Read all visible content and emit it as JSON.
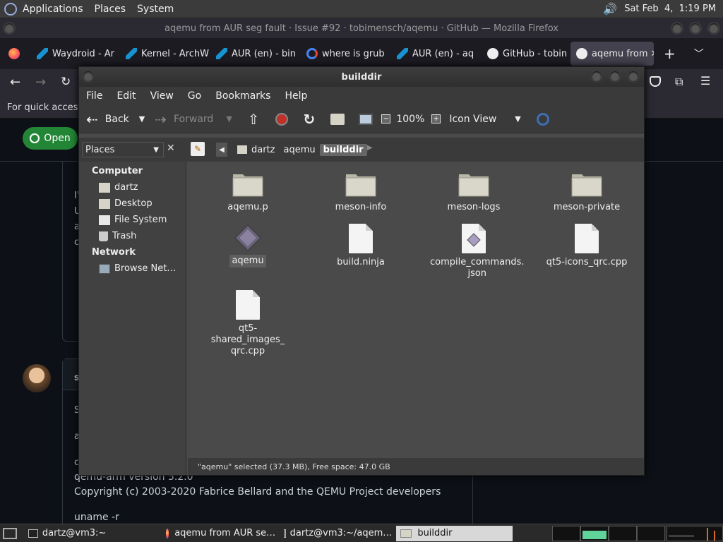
{
  "top_panel": {
    "menus": [
      "Applications",
      "Places",
      "System"
    ],
    "clock": "Sat Feb  4,  1:19 PM"
  },
  "firefox": {
    "title": "aqemu from AUR seg fault · Issue #92 · tobimensch/aqemu · GitHub — Mozilla Firefox",
    "tabs": [
      {
        "label": "Waydroid - Ar",
        "icon": "arch-icon"
      },
      {
        "label": "Kernel - ArchW",
        "icon": "arch-icon"
      },
      {
        "label": "AUR (en) - bin",
        "icon": "arch-icon"
      },
      {
        "label": "where is grub",
        "icon": "google-icon"
      },
      {
        "label": "AUR (en) - aq",
        "icon": "arch-icon"
      },
      {
        "label": "GitHub - tobin",
        "icon": "github-icon"
      },
      {
        "label": "aqemu from",
        "icon": "github-icon"
      }
    ],
    "bookmarks_text": "For quick access,"
  },
  "github": {
    "open_badge": "Open",
    "comment_lines": [
      "I'",
      "U",
      "a",
      "c"
    ],
    "second_comment": {
      "author_initial": "s",
      "lines": [
        "S",
        "a",
        "c",
        "qemu-arm version 5.2.0",
        "Copyright (c) 2003-2020 Fabrice Bellard and the QEMU Project developers",
        "uname -r"
      ]
    }
  },
  "nautilus": {
    "title": "builddir",
    "menu": [
      "File",
      "Edit",
      "View",
      "Go",
      "Bookmarks",
      "Help"
    ],
    "toolbar": {
      "back": "Back",
      "forward": "Forward",
      "zoom": "100%",
      "view_mode": "Icon View"
    },
    "sidebar": {
      "selector": "Places",
      "sections": [
        {
          "heading": "Computer",
          "items": [
            {
              "label": "dartz",
              "icon": "home-folder-icon"
            },
            {
              "label": "Desktop",
              "icon": "desktop-folder-icon"
            },
            {
              "label": "File System",
              "icon": "filesystem-icon"
            },
            {
              "label": "Trash",
              "icon": "trash-icon"
            }
          ]
        },
        {
          "heading": "Network",
          "items": [
            {
              "label": "Browse Net…",
              "icon": "network-icon"
            }
          ]
        }
      ]
    },
    "breadcrumbs": [
      "dartz",
      "aqemu",
      "builddir"
    ],
    "files": [
      {
        "name": "aqemu.p",
        "type": "folder"
      },
      {
        "name": "meson-info",
        "type": "folder"
      },
      {
        "name": "meson-logs",
        "type": "folder"
      },
      {
        "name": "meson-private",
        "type": "folder"
      },
      {
        "name": "aqemu",
        "type": "executable",
        "selected": true
      },
      {
        "name": "build.ninja",
        "type": "document"
      },
      {
        "name": "compile_commands.\njson",
        "type": "json"
      },
      {
        "name": "qt5-icons_qrc.cpp",
        "type": "document"
      },
      {
        "name": "qt5-shared_images_\nqrc.cpp",
        "type": "document"
      }
    ],
    "status": "\"aqemu\" selected (37.3 MB), Free space: 47.0 GB"
  },
  "taskbar": {
    "items": [
      {
        "label": "dartz@vm3:~",
        "icon": "terminal-icon"
      },
      {
        "label": "aqemu from AUR se…",
        "icon": "firefox-icon"
      },
      {
        "label": "dartz@vm3:~/aqem…",
        "icon": "terminal-icon"
      },
      {
        "label": "builddir",
        "icon": "folder-icon"
      }
    ]
  },
  "colors": {
    "panel": "#3b3b3b",
    "github_bg": "#0d1117",
    "open_green": "#238636",
    "nautilus_bg": "#4a4a4a",
    "folder": "#d6d4c6"
  }
}
